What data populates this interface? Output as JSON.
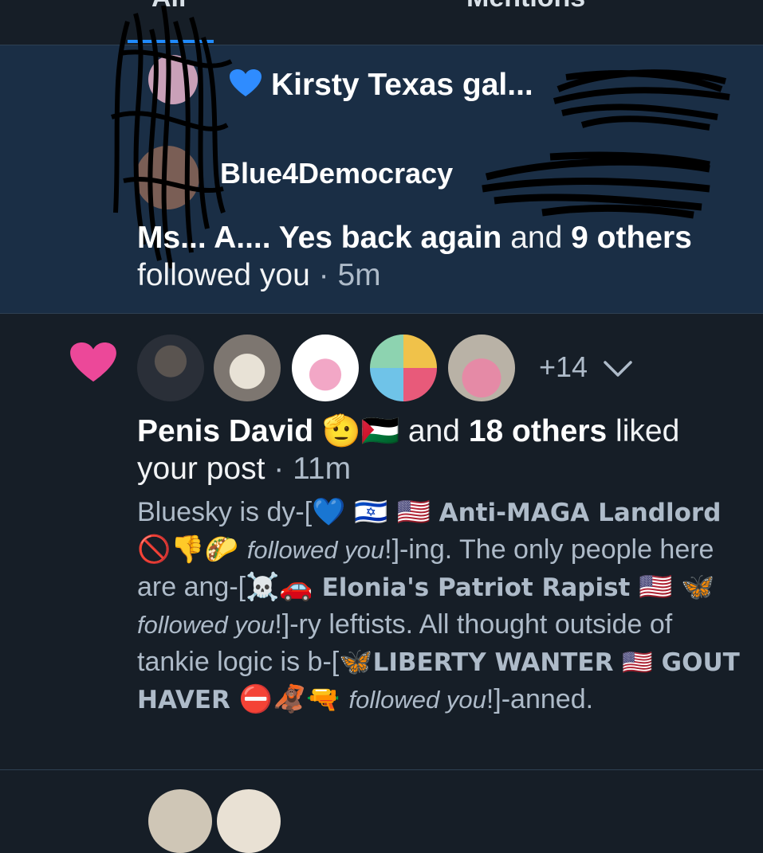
{
  "tabs": {
    "all_label": "All",
    "mentions_label": "Mentions",
    "accent": "#208bfe"
  },
  "follow_notification": {
    "first_name": "Kirsty Texas gal...",
    "first_handle_partial": "@",
    "second_name": "Blue4Democracy",
    "text_name": "Ms... A.... Yes back again",
    "text_and": " and ",
    "text_others": "9 others",
    "text_action": " followed you",
    "text_sep": " · ",
    "time": "5m"
  },
  "like_notification": {
    "heart_color": "#ec4899",
    "more_count": "+14",
    "liker_name": "Penis David",
    "liker_emojis": "🫡🇵🇸",
    "text_and": " and ",
    "text_others": "18 others",
    "text_action": " liked your post",
    "text_sep": " · ",
    "time": "11m",
    "post": {
      "seg1": "Bluesky is dy-[",
      "e1": "💙 🇮🇱 🇺🇸 ",
      "n1": "Anti-MAGA Landlord",
      "e2": " 🚫👎🌮 ",
      "f1": "followed you",
      "seg2": "!]-ing. The only people here are ang-[",
      "e3": "☠️🚗 ",
      "n2": "Elonia's Patriot Rapist",
      "e4": " 🇺🇸 🦋 ",
      "f2": "followed you",
      "seg3": "!]-ry leftists. All thought outside of tankie logic is b-[",
      "e5": "🦋",
      "n3": "LIBERTY WANTER 🇺🇸 GOUT HAVER",
      "e6": " ⛔🦧🔫 ",
      "f3": "followed you",
      "seg4": "!]-anned."
    }
  }
}
